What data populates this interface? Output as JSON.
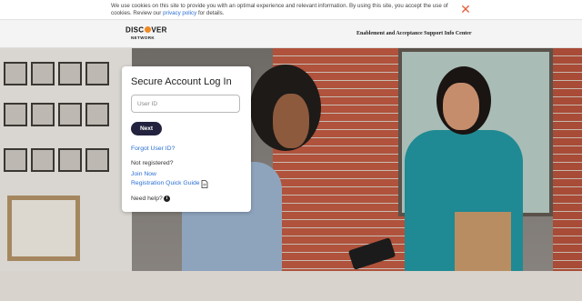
{
  "cookie_banner": {
    "text": "We use cookies on this site to provide you with an optimal experience and relevant information. By using this site, you accept the use of cookies. Review our ",
    "link_text": "privacy policy",
    "text_end": " for details.",
    "close_icon": "close-x-icon"
  },
  "header": {
    "logo_top_left": "DISC",
    "logo_top_right": "VER",
    "logo_bottom": "NETWORK",
    "title": "Enablement and Acceptance Support Info Center"
  },
  "login": {
    "title": "Secure Account Log In",
    "user_id_placeholder": "User ID",
    "next_label": "Next",
    "forgot_label": "Forgot User ID?",
    "not_registered": "Not registered?",
    "join_label": "Join Now",
    "guide_label": "Registration Quick Guide",
    "guide_icon": "document-icon",
    "need_help": "Need help?",
    "help_icon": "info-icon"
  },
  "colors": {
    "accent": "#2a6fd1",
    "button": "#23233f",
    "close": "#e8603c",
    "logo_dot": "#f08a24"
  }
}
